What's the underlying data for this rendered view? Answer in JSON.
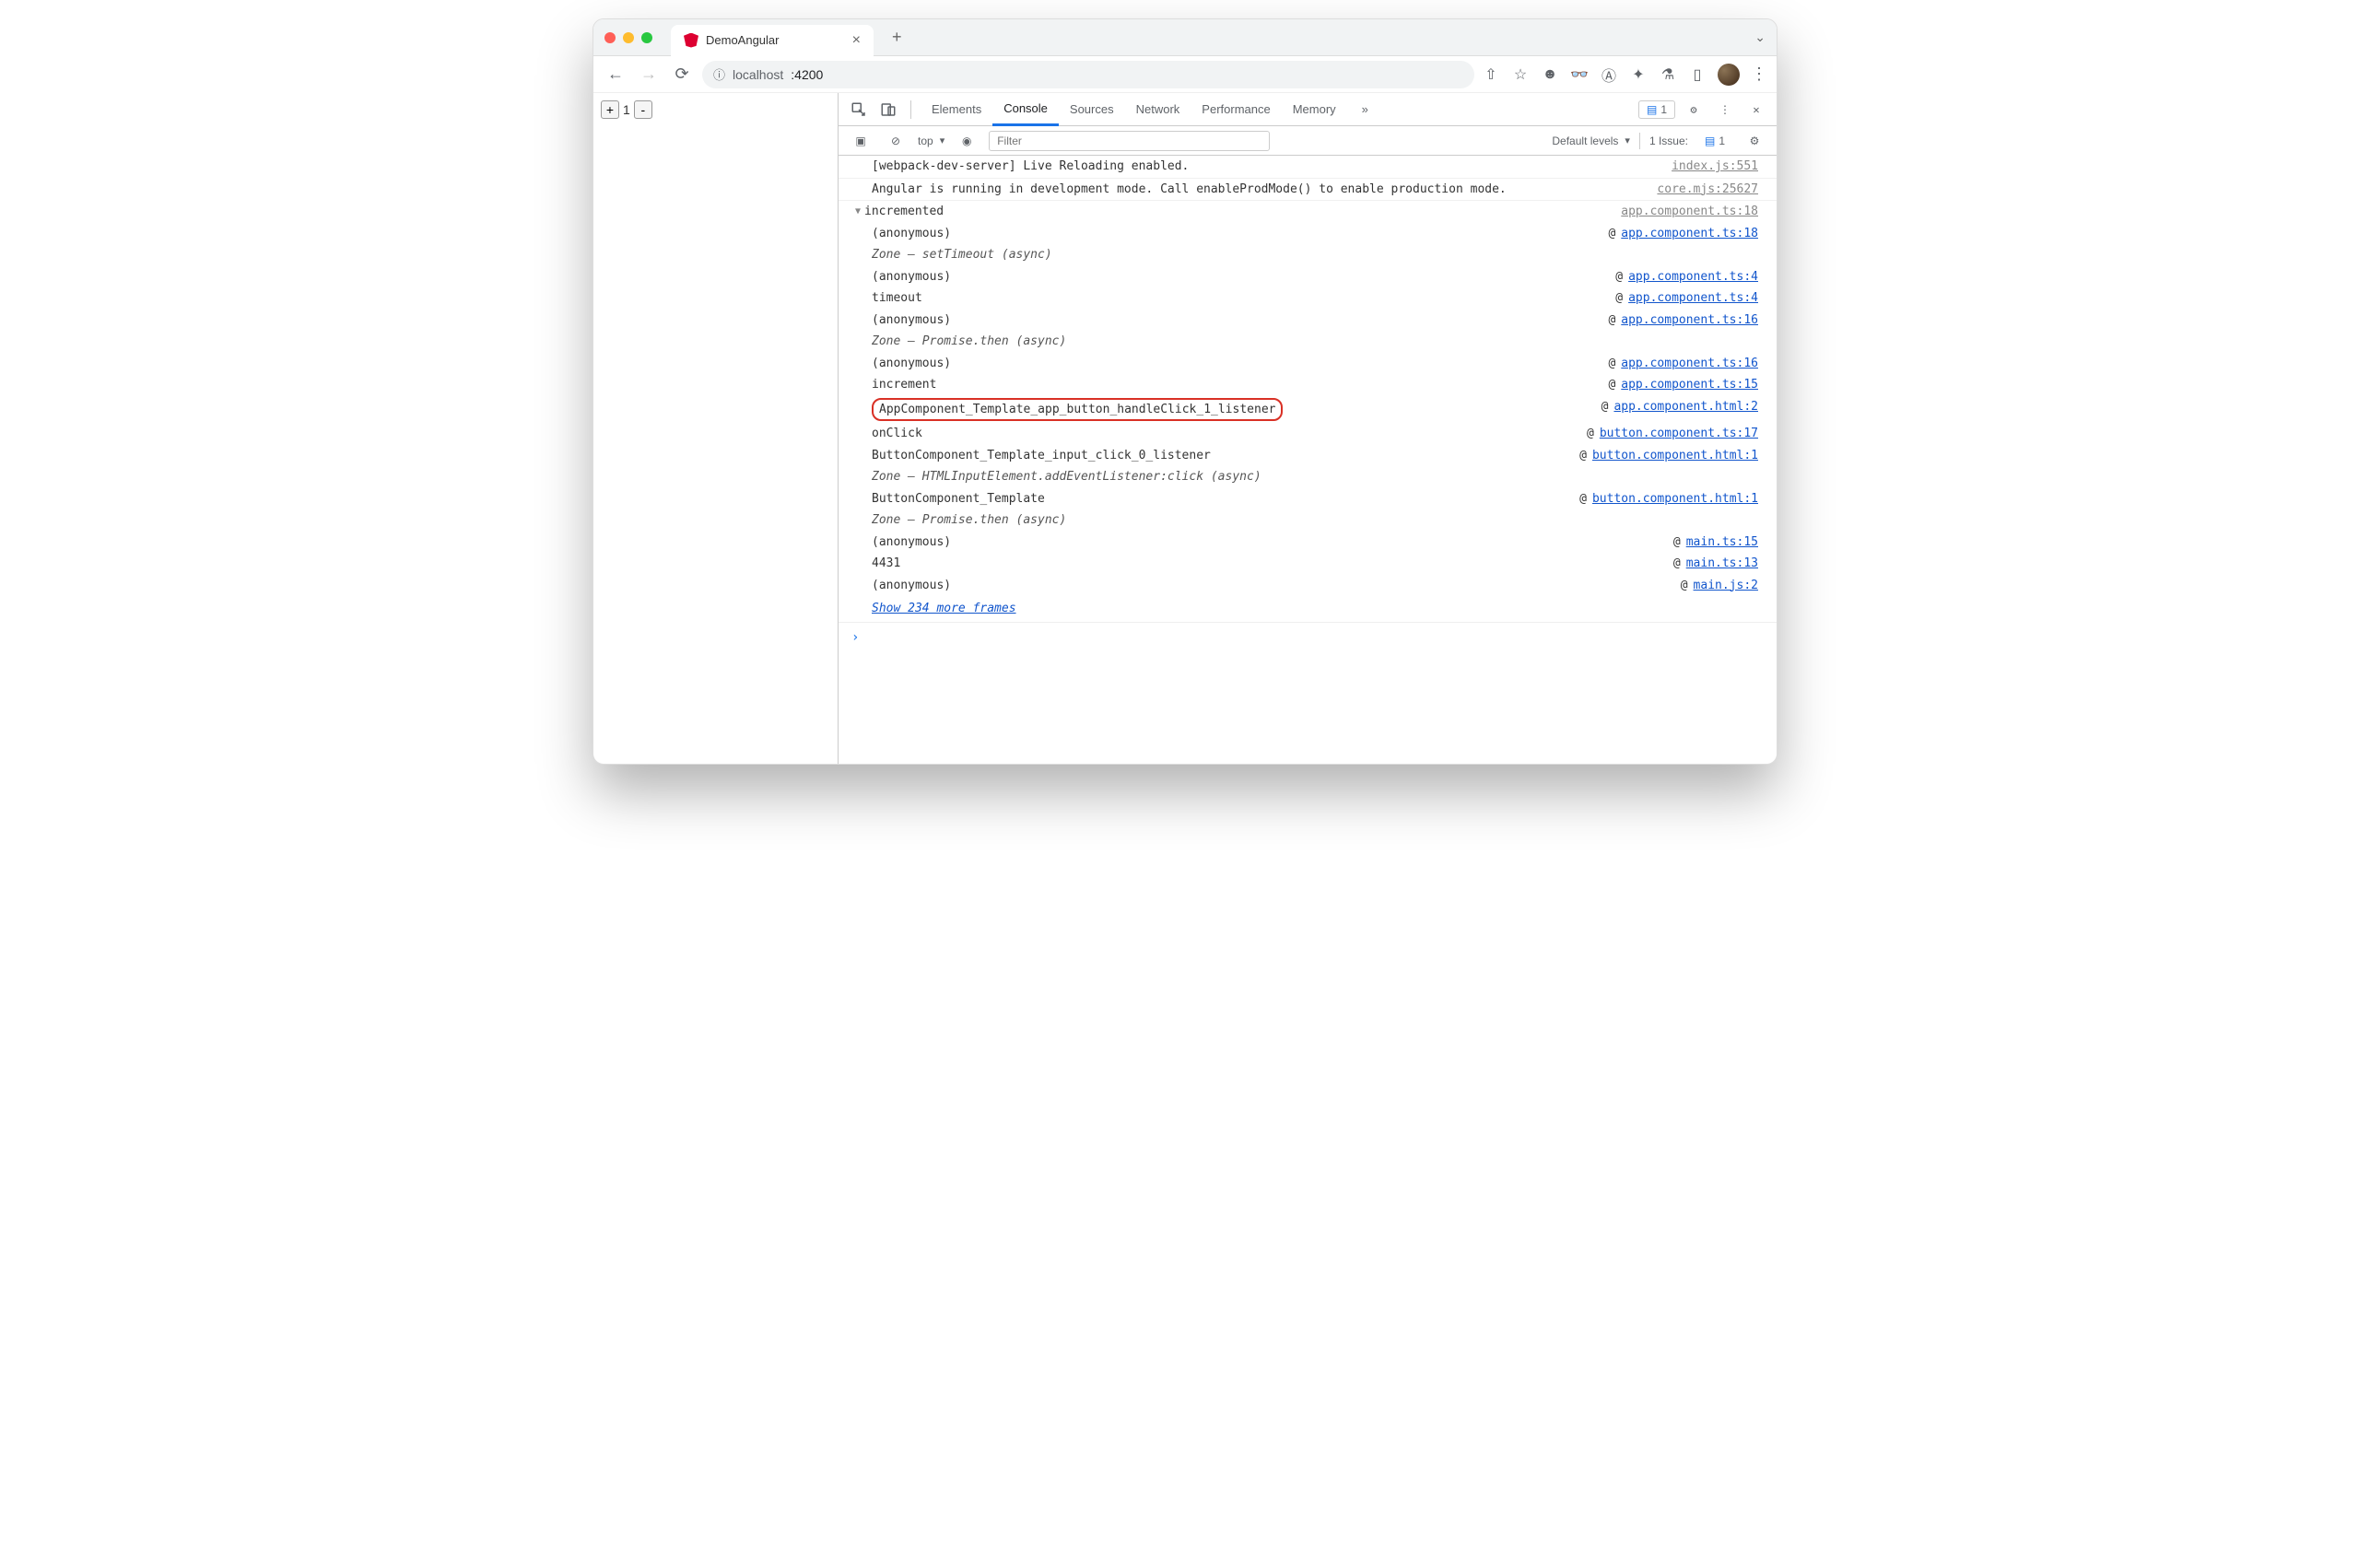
{
  "browser": {
    "tab": {
      "title": "DemoAngular",
      "favicon": "angular"
    },
    "url": {
      "host": "localhost",
      "port": ":4200"
    },
    "ext_icons": [
      "share",
      "star",
      "skull",
      "incognito",
      "privacy",
      "puzzle",
      "flask",
      "panel"
    ]
  },
  "page": {
    "counter_value": "1"
  },
  "devtools": {
    "tabs": [
      "Elements",
      "Console",
      "Sources",
      "Network",
      "Performance",
      "Memory"
    ],
    "active_tab": "Console",
    "more": "»",
    "issues_badge": "1",
    "toolbar": {
      "context": "top",
      "filter_placeholder": "Filter",
      "levels": "Default levels",
      "issue_label": "1 Issue:",
      "issue_count": "1"
    },
    "logs": [
      {
        "msg": "[webpack-dev-server] Live Reloading enabled.",
        "src": "index.js:551"
      },
      {
        "msg": "Angular is running in development mode. Call enableProdMode() to enable production mode.",
        "src": "core.mjs:25627"
      }
    ],
    "trace": {
      "label": "incremented",
      "src": "app.component.ts:18",
      "frames": [
        {
          "fn": "(anonymous)",
          "loc": "app.component.ts:18"
        },
        {
          "fn": "Zone – setTimeout (async)",
          "italic": true
        },
        {
          "fn": "(anonymous)",
          "loc": "app.component.ts:4"
        },
        {
          "fn": "timeout",
          "loc": "app.component.ts:4"
        },
        {
          "fn": "(anonymous)",
          "loc": "app.component.ts:16"
        },
        {
          "fn": "Zone – Promise.then (async)",
          "italic": true
        },
        {
          "fn": "(anonymous)",
          "loc": "app.component.ts:16"
        },
        {
          "fn": "increment",
          "loc": "app.component.ts:15"
        },
        {
          "fn": "AppComponent_Template_app_button_handleClick_1_listener",
          "loc": "app.component.html:2",
          "highlight": true
        },
        {
          "fn": "onClick",
          "loc": "button.component.ts:17"
        },
        {
          "fn": "ButtonComponent_Template_input_click_0_listener",
          "loc": "button.component.html:1"
        },
        {
          "fn": "Zone – HTMLInputElement.addEventListener:click (async)",
          "italic": true
        },
        {
          "fn": "ButtonComponent_Template",
          "loc": "button.component.html:1"
        },
        {
          "fn": "Zone – Promise.then (async)",
          "italic": true
        },
        {
          "fn": "(anonymous)",
          "loc": "main.ts:15"
        },
        {
          "fn": "4431",
          "loc": "main.ts:13"
        },
        {
          "fn": "(anonymous)",
          "loc": "main.js:2"
        }
      ],
      "show_more": "Show 234 more frames"
    }
  }
}
